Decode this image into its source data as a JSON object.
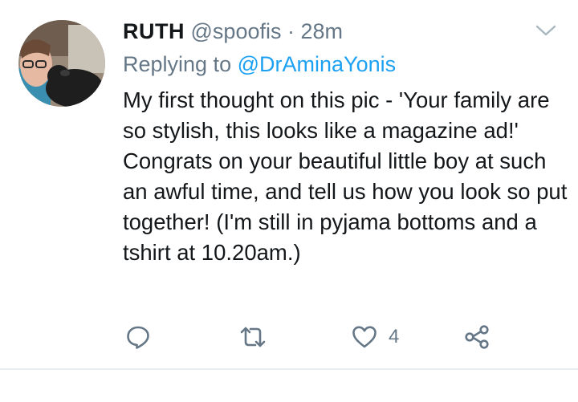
{
  "tweet": {
    "author_name": "RUTH",
    "author_handle": "@spoofis",
    "separator": "·",
    "timestamp": "28m",
    "replying_label": "Replying to",
    "replying_handle": "@DrAminaYonis",
    "text": "My first thought on this pic - 'Your family are so stylish, this looks like a magazine ad!'  Congrats on your beautiful little boy at such an awful time, and tell us how you look so put together!  (I'm still in pyjama bottoms and a tshirt at 10.20am.)",
    "like_count": "4"
  },
  "icons": {
    "menu": "chevron-down-icon",
    "reply": "reply-icon",
    "retweet": "retweet-icon",
    "like": "heart-icon",
    "share": "share-icon"
  },
  "colors": {
    "text_primary": "#14171a",
    "text_secondary": "#657786",
    "link": "#1da1f2",
    "divider": "#e6ecf0"
  }
}
